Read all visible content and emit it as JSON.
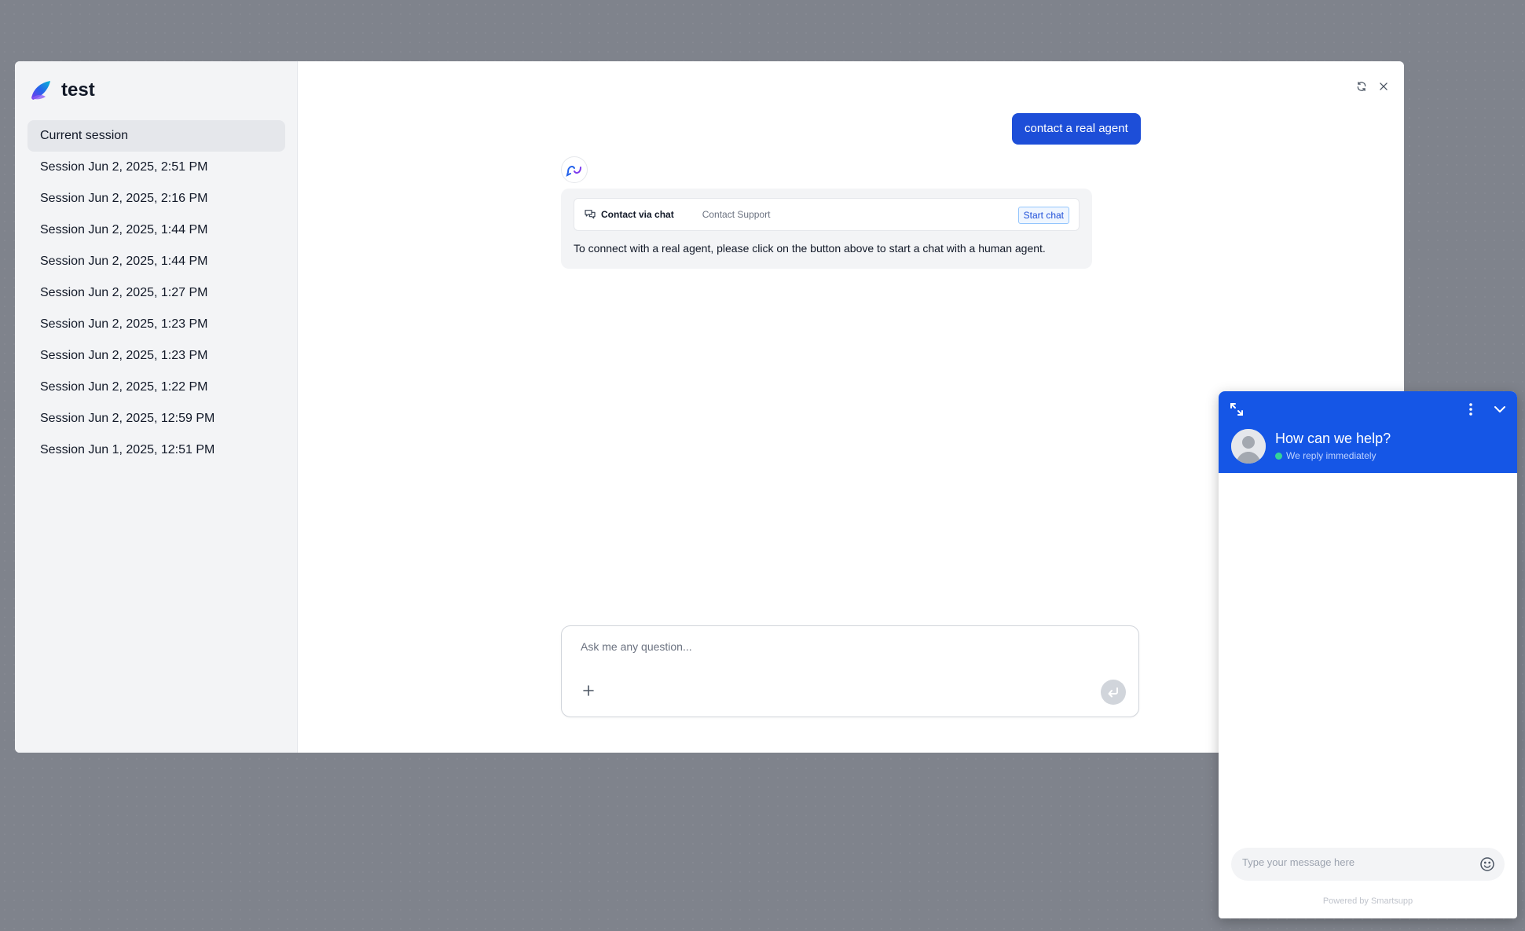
{
  "app": {
    "name": "test"
  },
  "sidebar": {
    "items": [
      {
        "label": "Current session",
        "active": true
      },
      {
        "label": "Session Jun 2, 2025, 2:51 PM"
      },
      {
        "label": "Session Jun 2, 2025, 2:16 PM"
      },
      {
        "label": "Session Jun 2, 2025, 1:44 PM"
      },
      {
        "label": "Session Jun 2, 2025, 1:44 PM"
      },
      {
        "label": "Session Jun 2, 2025, 1:27 PM"
      },
      {
        "label": "Session Jun 2, 2025, 1:23 PM"
      },
      {
        "label": "Session Jun 2, 2025, 1:23 PM"
      },
      {
        "label": "Session Jun 2, 2025, 1:22 PM"
      },
      {
        "label": "Session Jun 2, 2025, 12:59 PM"
      },
      {
        "label": "Session Jun 1, 2025, 12:51 PM"
      }
    ]
  },
  "chat": {
    "user_message": "contact a real agent",
    "contact_card": {
      "label": "Contact via chat",
      "sub": "Contact Support",
      "button": "Start chat"
    },
    "bot_text": "To connect with a real agent, please click on the button above to start a chat with a human agent.",
    "composer_placeholder": "Ask me any question..."
  },
  "widget": {
    "title": "How can we help?",
    "status": "We reply immediately",
    "input_placeholder": "Type your message here",
    "powered_by": "Powered by Smartsupp"
  },
  "colors": {
    "accent": "#1d4ed8",
    "widget_header": "#1556e6",
    "online": "#34d399",
    "backdrop": "#7f838c"
  },
  "icons": [
    "brand-logo",
    "refresh-icon",
    "close-icon",
    "bot-avatar-icon",
    "chat-icon",
    "plus-icon",
    "send-icon",
    "expand-icon",
    "menu-dots-icon",
    "chevron-down-icon",
    "user-avatar-icon",
    "emoji-icon"
  ]
}
